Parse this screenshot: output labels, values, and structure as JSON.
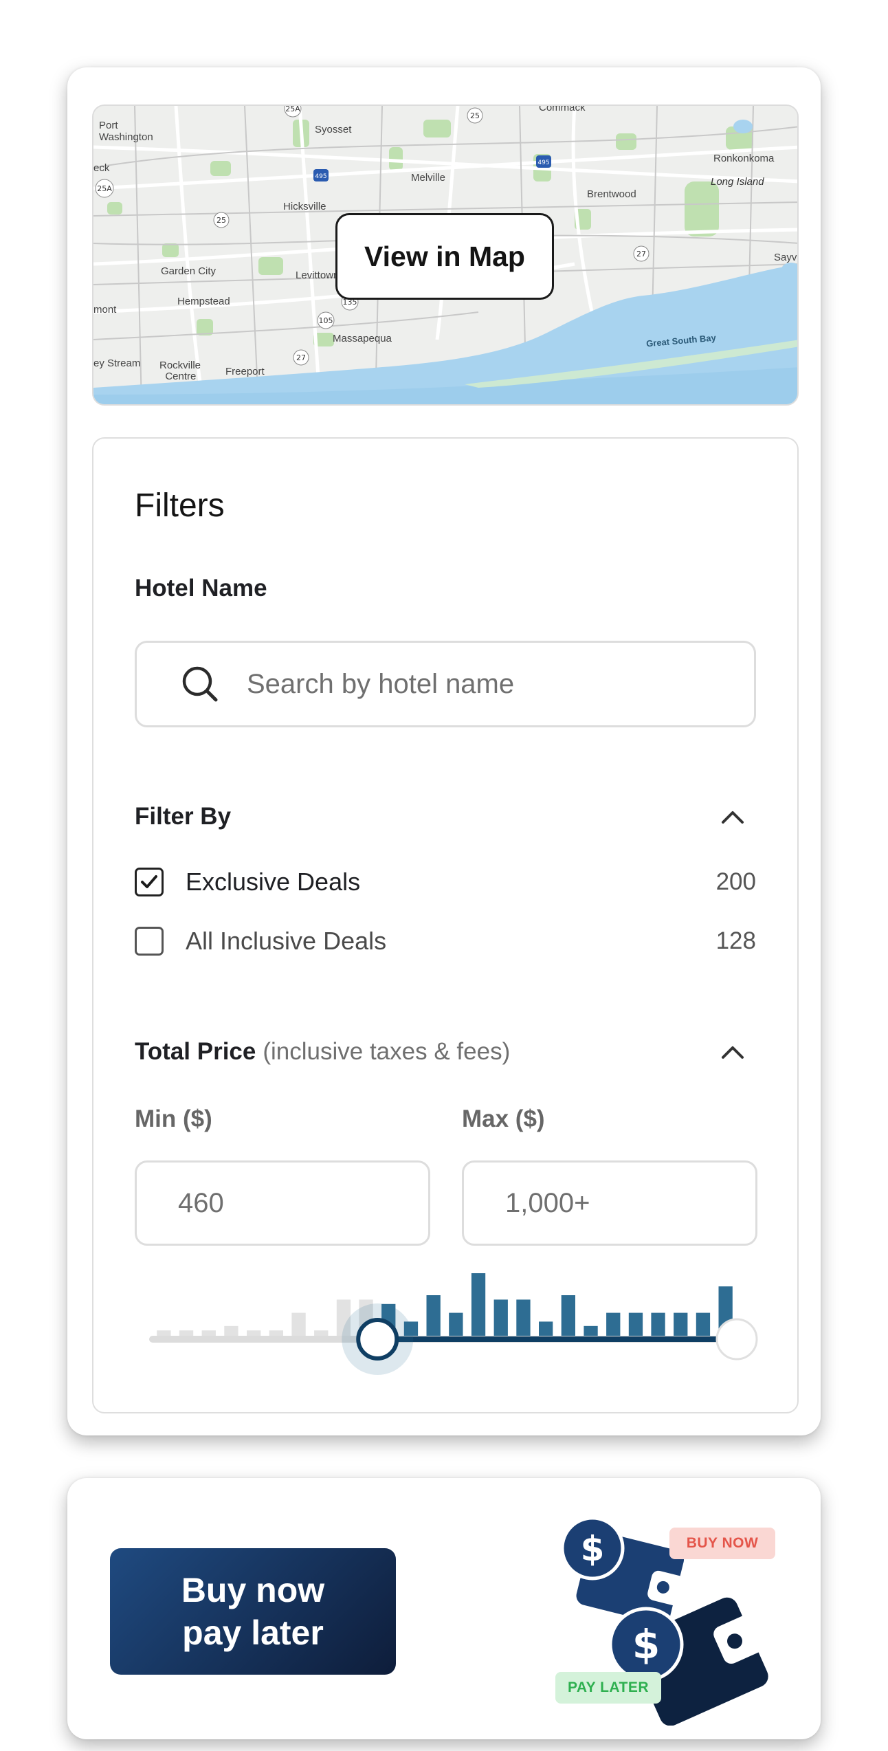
{
  "map": {
    "button_label": "View in Map",
    "labels": [
      {
        "text": "Port\nWashington",
        "kind": "town"
      },
      {
        "text": "Syosset",
        "kind": "town"
      },
      {
        "text": "Commack",
        "kind": "town"
      },
      {
        "text": "Ronkonkoma",
        "kind": "town"
      },
      {
        "text": "Long Island",
        "kind": "region"
      },
      {
        "text": "Melville",
        "kind": "town"
      },
      {
        "text": "Brentwood",
        "kind": "town"
      },
      {
        "text": "Hicksville",
        "kind": "town"
      },
      {
        "text": "Garden City",
        "kind": "town"
      },
      {
        "text": "Levittown",
        "kind": "town"
      },
      {
        "text": "Hempstead",
        "kind": "town"
      },
      {
        "text": "Massapequa",
        "kind": "town"
      },
      {
        "text": "Rockville\nCentre",
        "kind": "town"
      },
      {
        "text": "Freeport",
        "kind": "town"
      },
      {
        "text": "Great South Bay",
        "kind": "water"
      },
      {
        "text": "Sayvi",
        "kind": "town"
      },
      {
        "text": "eck",
        "kind": "town"
      },
      {
        "text": "mont",
        "kind": "town"
      },
      {
        "text": "ey Stream",
        "kind": "town"
      }
    ],
    "road_shields": [
      "25A",
      "25",
      "495",
      "495",
      "25",
      "27",
      "135",
      "105",
      "27",
      "25A",
      "25"
    ]
  },
  "filters": {
    "title": "Filters",
    "hotel_name_label": "Hotel Name",
    "search_placeholder": "Search by hotel name",
    "filter_by_label": "Filter By",
    "options": [
      {
        "label": "Exclusive Deals",
        "count": "200",
        "checked": true
      },
      {
        "label": "All Inclusive Deals",
        "count": "128",
        "checked": false
      }
    ],
    "total_price_label": "Total Price",
    "total_price_sub": "(inclusive taxes & fees)",
    "min_label": "Min ($)",
    "max_label": "Max ($)",
    "min_value": "460",
    "max_value": "1,000+",
    "histogram": {
      "values": [
        2,
        2,
        2,
        3,
        2,
        2,
        6,
        2,
        9,
        9,
        8,
        4,
        10,
        6,
        15,
        9,
        9,
        4,
        10,
        3,
        6,
        6,
        6,
        6,
        6,
        12
      ],
      "selected_from_index": 10,
      "slider_min_fraction": 0.385,
      "slider_max_fraction": 1.0
    },
    "colors": {
      "active_bar": "#2e6d93",
      "inactive_bar": "#e2e2e2",
      "track_active": "#0f3e63"
    }
  },
  "promo": {
    "button_line1": "Buy now",
    "button_line2": "pay later",
    "pill_buy_now": "BUY NOW",
    "pill_pay_later": "PAY LATER",
    "colors": {
      "button": "#163566",
      "pill_buy_bg": "#fad7d3",
      "pill_buy_text": "#e4554a",
      "pill_later_bg": "#d4f2da",
      "pill_later_text": "#2fb050"
    }
  }
}
